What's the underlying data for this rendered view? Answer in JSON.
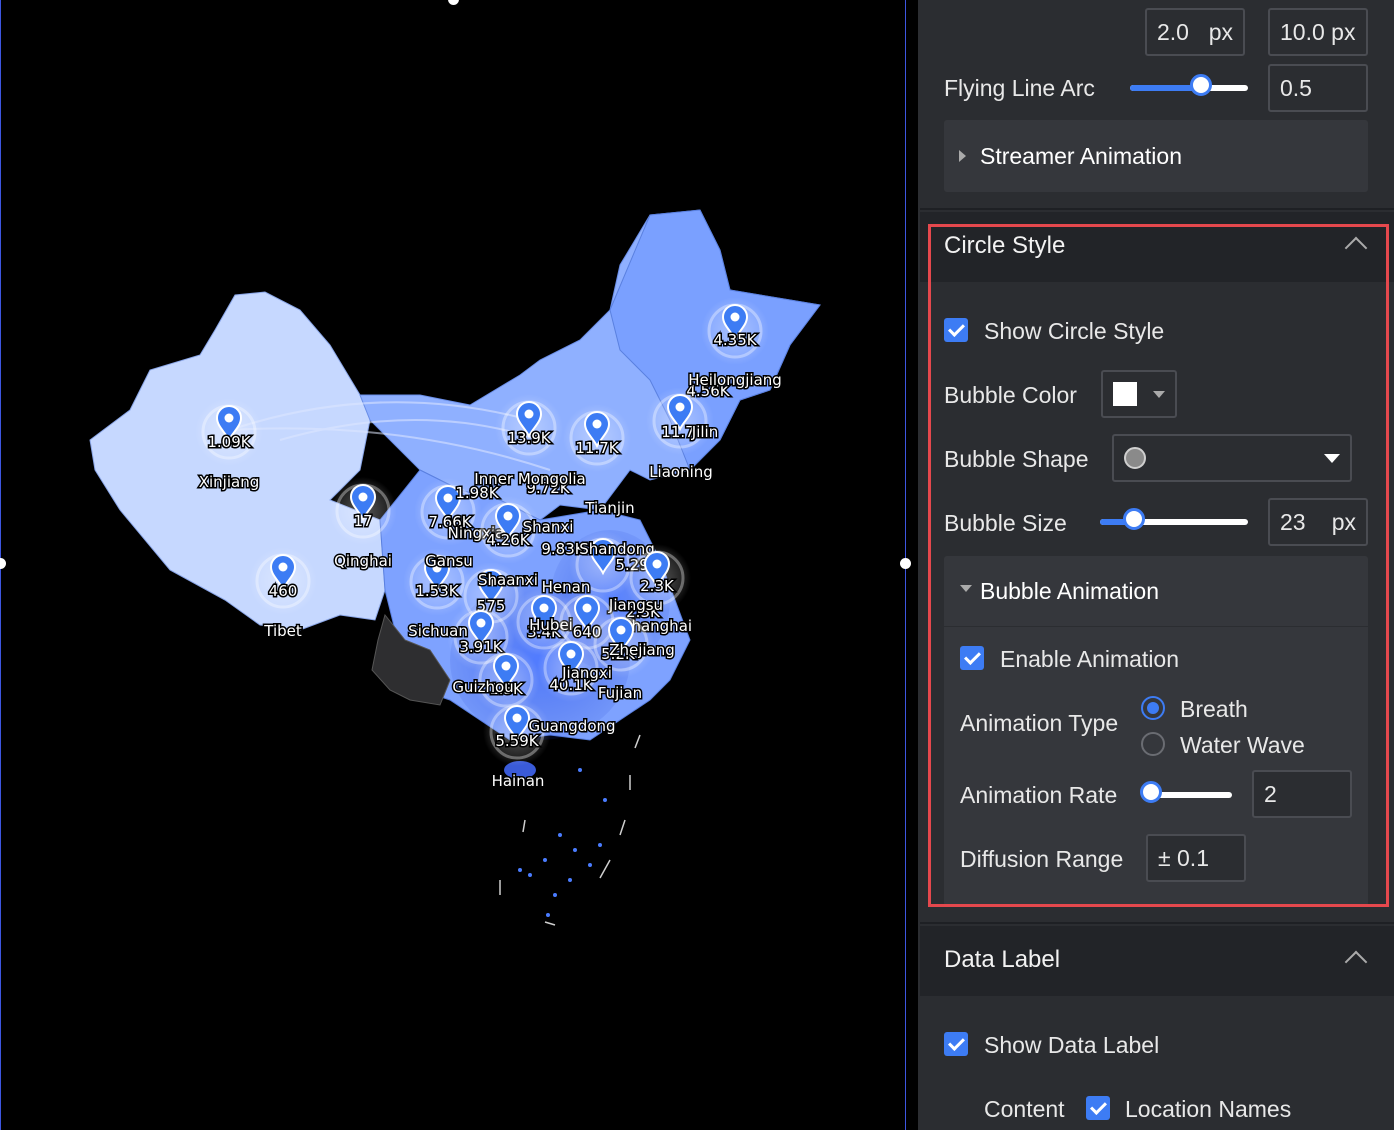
{
  "map": {
    "markers": [
      {
        "id": "heilongjiang",
        "value": "4.35K",
        "name": "Heilongjiang",
        "value2": "4.56K"
      },
      {
        "id": "jilin",
        "value": "11.7",
        "name": "Jilin"
      },
      {
        "id": "liaoning",
        "name": "Liaoning"
      },
      {
        "id": "xinjiang",
        "value": "1.09K",
        "name": "Xinjiang"
      },
      {
        "id": "qinghai",
        "value": "17",
        "name": "Qinghai"
      },
      {
        "id": "tibet",
        "value": "460",
        "name": "Tibet"
      },
      {
        "id": "innermongolia",
        "value": "13.9K",
        "name": "Inner Mongolia",
        "value2": "9.72K"
      },
      {
        "id": "beijing",
        "value": "11.7K"
      },
      {
        "id": "tianjin",
        "name": "Tianjin"
      },
      {
        "id": "ningxia",
        "value": "7.66K",
        "name": "Ningxia",
        "value2": "1.98K"
      },
      {
        "id": "shanxi",
        "value": "4.26K",
        "name": "Shanxi"
      },
      {
        "id": "shandong",
        "value": "9.83K",
        "name": "Shandong",
        "value2": "5.29K"
      },
      {
        "id": "gansu",
        "value": "1.53K",
        "name": "Gansu"
      },
      {
        "id": "shaanxi",
        "value": "575",
        "name": "Shaanxi"
      },
      {
        "id": "henan",
        "name": "Henan"
      },
      {
        "id": "jiangsu",
        "value": "2.3K",
        "name": "Jiangsu",
        "value2": "2.3K"
      },
      {
        "id": "sichuan",
        "value": "3.91K",
        "name": "Sichuan"
      },
      {
        "id": "hubei",
        "value": "3.4K",
        "name": "Hubei"
      },
      {
        "id": "anhui",
        "value": "640"
      },
      {
        "id": "shanghai",
        "name": "Shanghai"
      },
      {
        "id": "zhejiang",
        "value": "5.2K",
        "name": "Zhejiang"
      },
      {
        "id": "guizhou",
        "value": "1.3K",
        "name": "Guizhou"
      },
      {
        "id": "jiangxi",
        "value": "40.1K",
        "name": "Jiangxi"
      },
      {
        "id": "fujian",
        "name": "Fujian"
      },
      {
        "id": "guangdong",
        "value": "5.59K",
        "name": "Guangdong"
      },
      {
        "id": "hainan",
        "name": "Hainan"
      }
    ]
  },
  "panel": {
    "line_width": {
      "min_value": "2.0",
      "min_unit": "px",
      "max_value": "10.0 px"
    },
    "flying_line_arc": {
      "label": "Flying Line Arc",
      "value": "0.5",
      "fraction": 0.6
    },
    "streamer_animation": {
      "label": "Streamer Animation"
    },
    "circle_style": {
      "title": "Circle Style",
      "show_label": "Show Circle Style",
      "show_checked": true,
      "bubble_color_label": "Bubble Color",
      "bubble_color": "#ffffff",
      "bubble_shape_label": "Bubble Shape",
      "bubble_size_label": "Bubble Size",
      "bubble_size_value": "23",
      "bubble_size_unit": "px",
      "bubble_size_fraction": 0.23,
      "bubble_animation": {
        "title": "Bubble Animation",
        "enable_label": "Enable Animation",
        "enable_checked": true,
        "type_label": "Animation Type",
        "options": [
          "Breath",
          "Water Wave"
        ],
        "selected": "Breath",
        "rate_label": "Animation Rate",
        "rate_value": "2",
        "rate_fraction": 0.02,
        "diffusion_label": "Diffusion Range",
        "diffusion_value": "± 0.1"
      }
    },
    "data_label": {
      "title": "Data Label",
      "show_label": "Show Data Label",
      "show_checked": true,
      "content_label": "Content",
      "location_names_label": "Location Names",
      "location_checked": true
    }
  },
  "colors": {
    "accent": "#3d7cf4",
    "highlight": "#e5484d",
    "canvas": "#000000",
    "panel": "#2b2d31"
  }
}
